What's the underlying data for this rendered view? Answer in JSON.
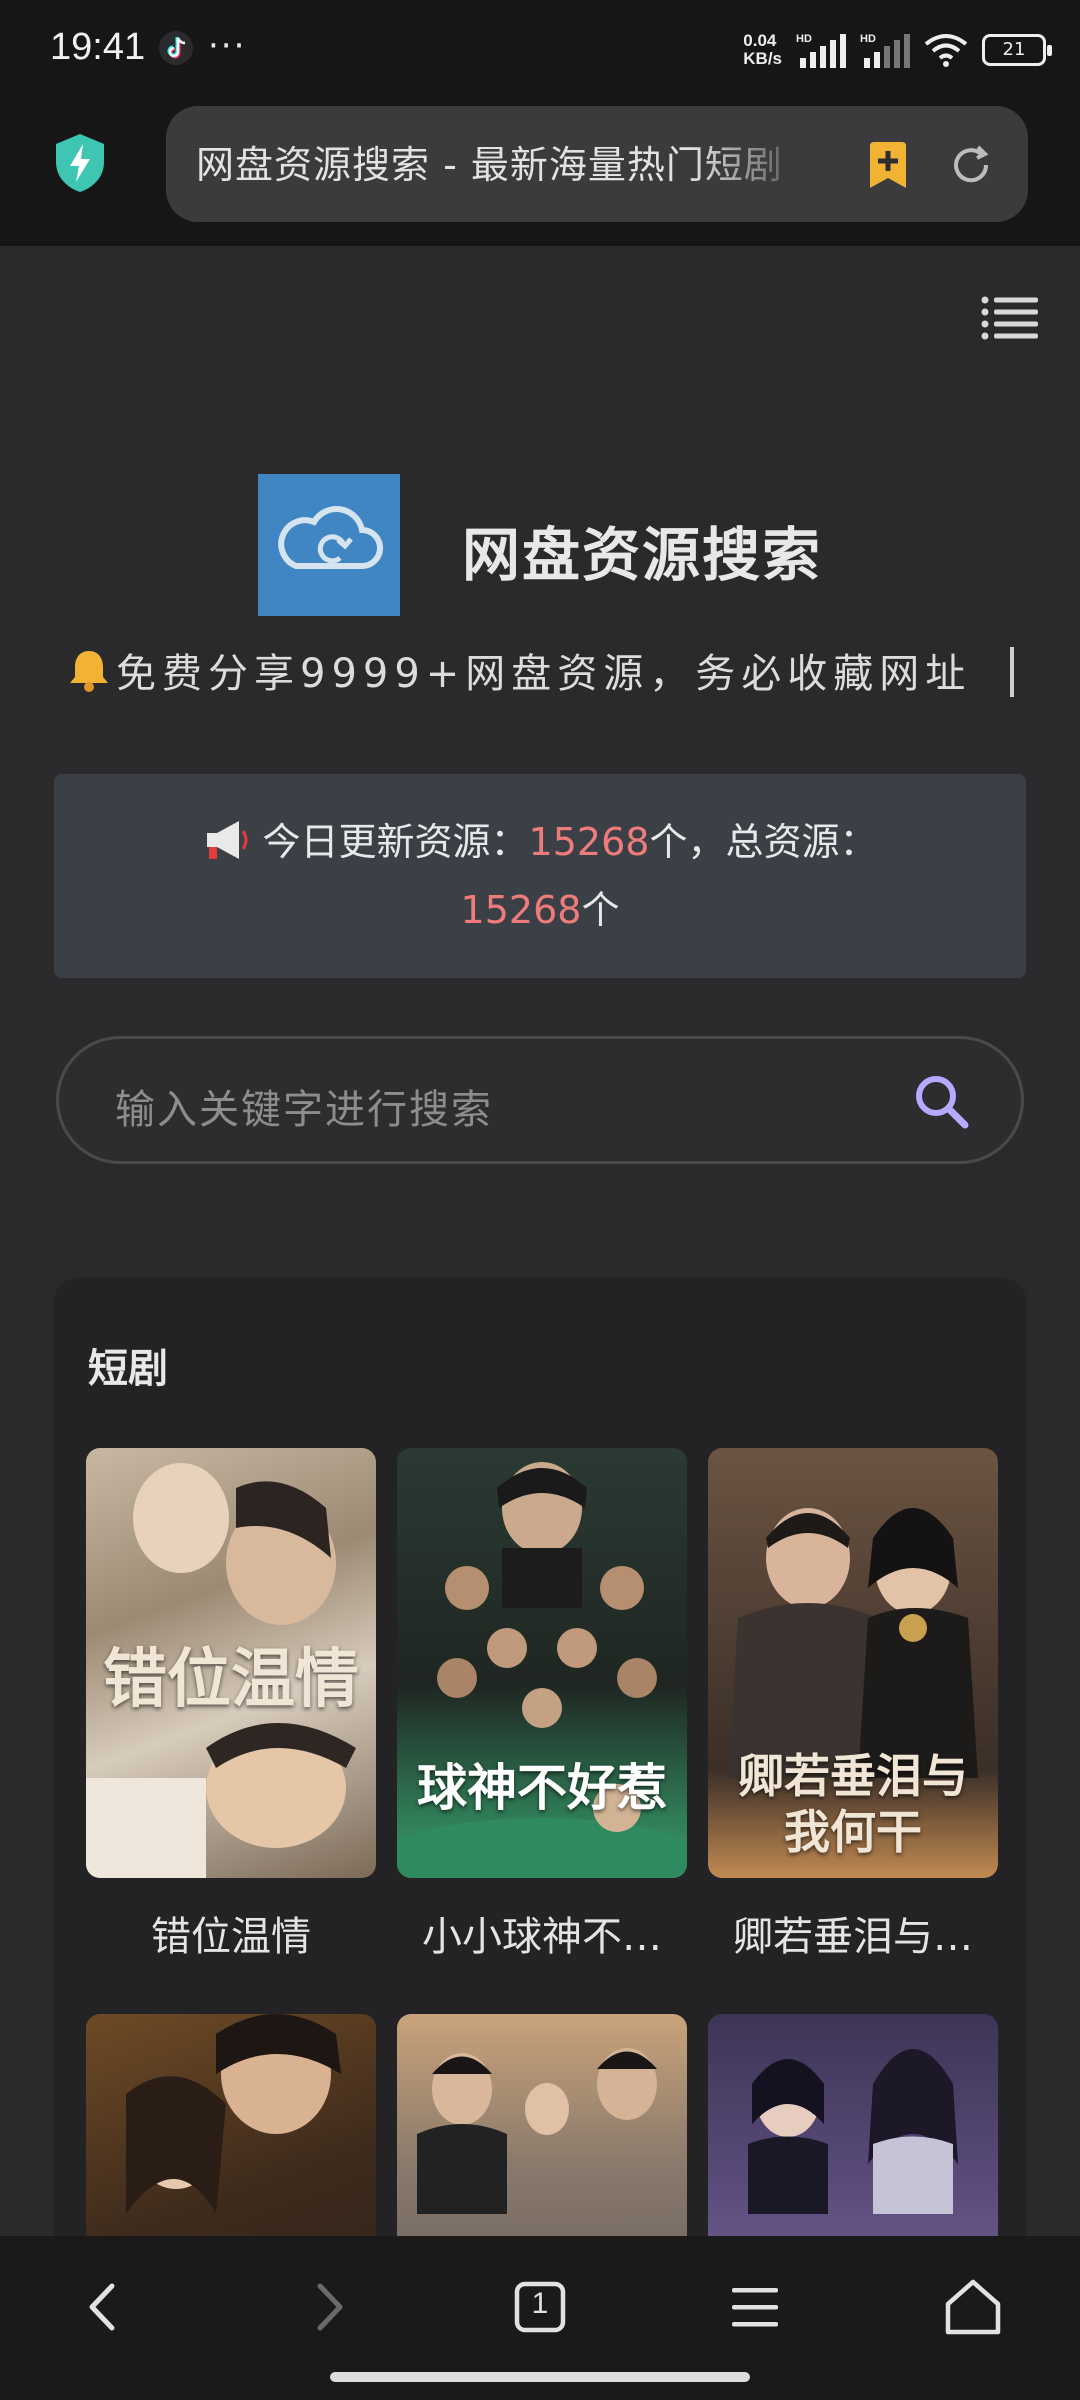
{
  "status_bar": {
    "time": "19:41",
    "overflow": "···",
    "net_speed_top": "0.04",
    "net_speed_bottom": "KB/s",
    "signal_label_1": "HD",
    "signal_label_2": "HD",
    "battery": "21"
  },
  "browser": {
    "url_title": "网盘资源搜索 - 最新海量热门短剧",
    "icons": [
      "shield-lightning-icon",
      "bookmark-add-icon",
      "reload-icon"
    ]
  },
  "site": {
    "title": "网盘资源搜索",
    "notice_text": "免费分享9999+网盘资源，务必收藏网址",
    "stats_prefix": "今日更新资源：",
    "today_count": "15268",
    "stats_middle": "个，总资源：",
    "total_count": "15268",
    "stats_suffix": "个",
    "search_placeholder": "输入关键字进行搜索"
  },
  "section": {
    "title": "短剧",
    "items": [
      {
        "caption": "错位温情",
        "poster_text": "错位温情"
      },
      {
        "caption": "小小球神不…",
        "poster_text": "球神不好惹"
      },
      {
        "caption": "卿若垂泪与…",
        "poster_text": "卿若垂泪与我何干"
      },
      {
        "caption": "",
        "poster_text": ""
      },
      {
        "caption": "",
        "poster_text": ""
      },
      {
        "caption": "",
        "poster_text": ""
      }
    ]
  },
  "bottom_nav": {
    "tab_count": "1",
    "icons": [
      "back-icon",
      "forward-icon",
      "tabs-icon",
      "menu-icon",
      "home-icon"
    ]
  },
  "colors": {
    "accent_number": "#f07b7b",
    "logo_blue": "#3f86c2",
    "search_icon": "#b9a8ff",
    "bookmark": "#f2b233",
    "shield": "#3ec6b3"
  }
}
